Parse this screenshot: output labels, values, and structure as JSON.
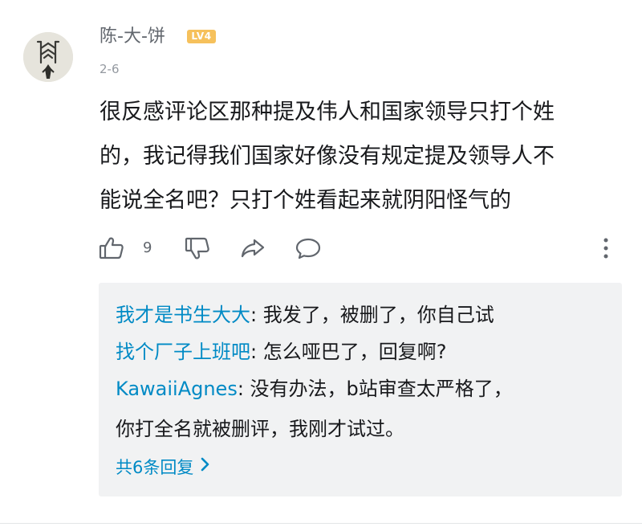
{
  "comment": {
    "username": "陈-大-饼",
    "level_badge": "LV4",
    "date": "2-6",
    "content_lines": [
      "很反感评论区那种提及伟人和国家领导只打个姓",
      "的，我记得我们国家好像没有规定提及领导人不",
      "能说全名吧？只打个姓看起来就阴阳怪气的"
    ],
    "likes": "9",
    "icons": {
      "avatar": "avatar-logo",
      "like": "thumbs-up-icon",
      "dislike": "thumbs-down-icon",
      "share": "share-icon",
      "reply": "comment-bubble-icon",
      "more": "more-vertical-icon"
    }
  },
  "replies": [
    {
      "user": "我才是书生大大",
      "separator": ": ",
      "text": "我发了，被删了，你自己试"
    },
    {
      "user": "找个厂子上班吧",
      "separator": ": ",
      "text": "怎么哑巴了，回复啊?"
    },
    {
      "user": "KawaiiAgnes",
      "separator": ": ",
      "text": "没有办法，b站审查太严格了，",
      "continuation": "你打全名就被删评，我刚才试过。"
    }
  ],
  "more_replies": {
    "label": "共6条回复",
    "icon": "chevron-right-icon"
  },
  "colors": {
    "link_blue": "#008ac5",
    "text_dark": "#18191c",
    "text_gray": "#61666d",
    "meta_gray": "#9499a0",
    "reply_bg": "#f1f2f3",
    "level_badge": "#f6c15c"
  }
}
